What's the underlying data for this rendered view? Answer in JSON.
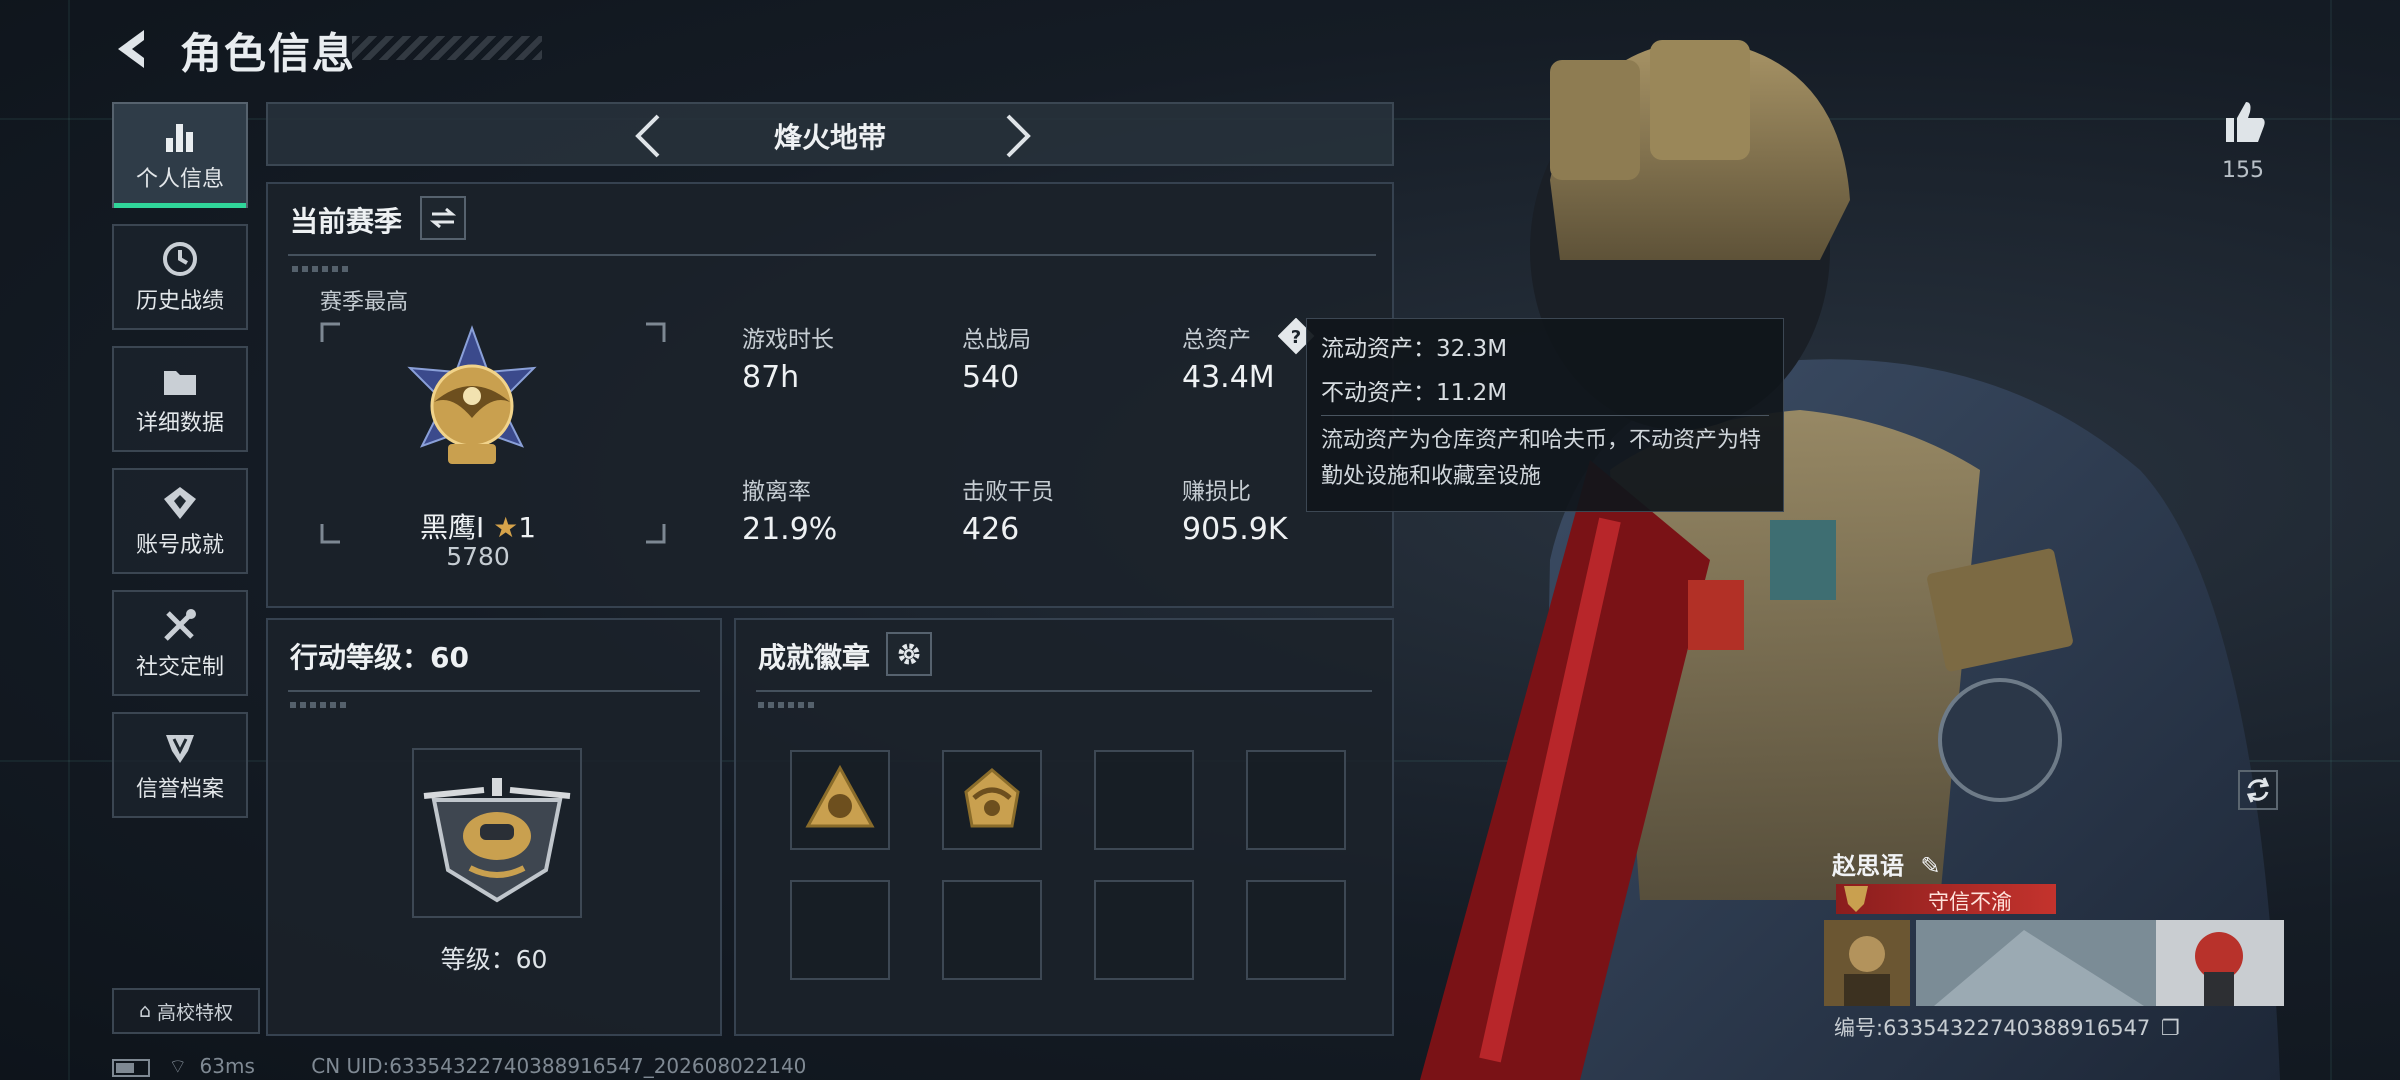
{
  "header": {
    "title": "角色信息"
  },
  "sidebar": {
    "items": [
      {
        "label": "个人信息",
        "icon": "bar-chart-icon",
        "active": true
      },
      {
        "label": "历史战绩",
        "icon": "clock-icon"
      },
      {
        "label": "详细数据",
        "icon": "folder-icon"
      },
      {
        "label": "账号成就",
        "icon": "achievement-icon"
      },
      {
        "label": "社交定制",
        "icon": "tools-icon"
      },
      {
        "label": "信誉档案",
        "icon": "shield-icon"
      }
    ],
    "campus_label": "高校特权"
  },
  "mode": {
    "title": "烽火地带"
  },
  "season": {
    "title": "当前赛季",
    "best_label": "赛季最高",
    "rank_name": "黑鹰I",
    "rank_star": "1",
    "rank_points": "5780",
    "stats": [
      {
        "label": "游戏时长",
        "value": "87h"
      },
      {
        "label": "总战局",
        "value": "540"
      },
      {
        "label": "总资产",
        "value": "43.4M"
      },
      {
        "label": "撤离率",
        "value": "21.9%"
      },
      {
        "label": "击败干员",
        "value": "426"
      },
      {
        "label": "赚损比",
        "value": "905.9K"
      }
    ]
  },
  "tooltip": {
    "line1": "流动资产：32.3M",
    "line2": "不动资产：11.2M",
    "note": "流动资产为仓库资产和哈夫币，不动资产为特勤处设施和收藏室设施"
  },
  "level": {
    "title": "行动等级：60",
    "label": "等级：60"
  },
  "badges": {
    "title": "成就徽章"
  },
  "status": {
    "ping": "63ms",
    "uid": "CN UID:6335432274038891654​7_202608022140"
  },
  "player": {
    "name": "赵思语",
    "title": "守信不渝",
    "id": "编号:6335432274038891654​7",
    "likes": "155"
  },
  "colors": {
    "accent": "#30d69a",
    "banner": "#c4332d",
    "gold": "#c9a04f"
  }
}
